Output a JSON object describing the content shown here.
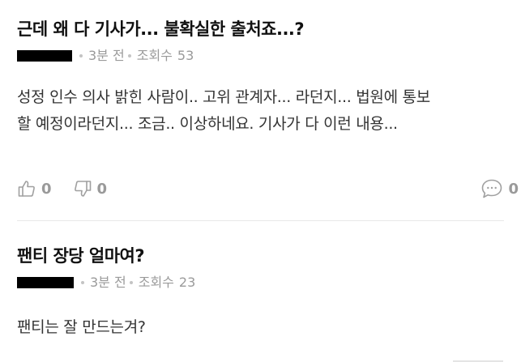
{
  "posts": [
    {
      "title": "근데 왜 다 기사가... 불확실한 출처죠...?",
      "time": "3분 전",
      "views_label": "조회수",
      "views": "53",
      "body_lines": [
        "성정 인수 의사 밝힌 사람이.. 고위 관계자... 라던지... 법원에 통보",
        "할 예정이라던지... 조금.. 이상하네요. 기사가 다 이런 내용..."
      ],
      "likes": "0",
      "dislikes": "0",
      "comments": "0"
    },
    {
      "title": "팬티 장당 얼마여?",
      "time": "3분 전",
      "views_label": "조회수",
      "views": "23",
      "body_lines": [
        "팬티는 잘 만드는겨?"
      ]
    }
  ],
  "icons": {
    "like": "thumbs-up-icon",
    "dislike": "thumbs-down-icon",
    "comment": "speech-bubble-icon"
  },
  "colors": {
    "title": "#111111",
    "meta": "#9a9a9a",
    "body": "#333333",
    "divider": "#e8e8e8",
    "author_mask": "#000000"
  }
}
